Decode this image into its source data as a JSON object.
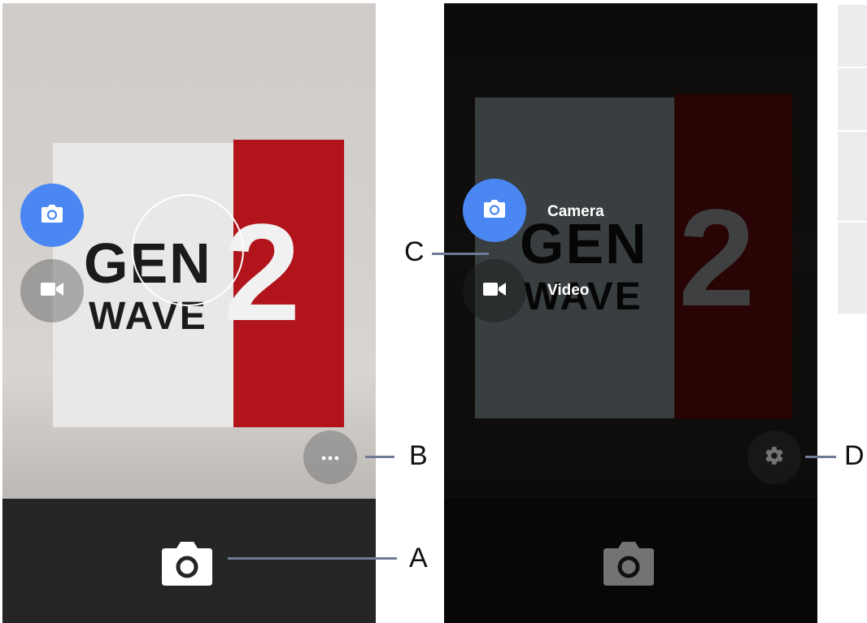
{
  "colors": {
    "accent_blue": "#4b87f3",
    "sign_red": "#b1141a",
    "bottom_bar": "#252525",
    "callout_line": "#6f7a96"
  },
  "left_screen": {
    "sign": {
      "word1": "GEN",
      "word2": "WAVE",
      "digit": "2"
    },
    "mode_switcher": {
      "camera_icon": "camera-icon",
      "video_icon": "video-camera-icon",
      "active_mode": "camera"
    },
    "more_options_icon": "more-horizontal-icon",
    "shutter_icon": "camera-shutter-icon"
  },
  "right_screen": {
    "sign": {
      "word1": "GEN",
      "word2": "WAVE",
      "digit": "2"
    },
    "mode_menu": {
      "camera_label": "Camera",
      "video_label": "Video",
      "active_mode": "camera"
    },
    "settings_icon": "gear-icon",
    "shutter_icon": "camera-shutter-icon"
  },
  "callouts": {
    "a": "A",
    "b": "B",
    "c": "C",
    "d": "D"
  }
}
